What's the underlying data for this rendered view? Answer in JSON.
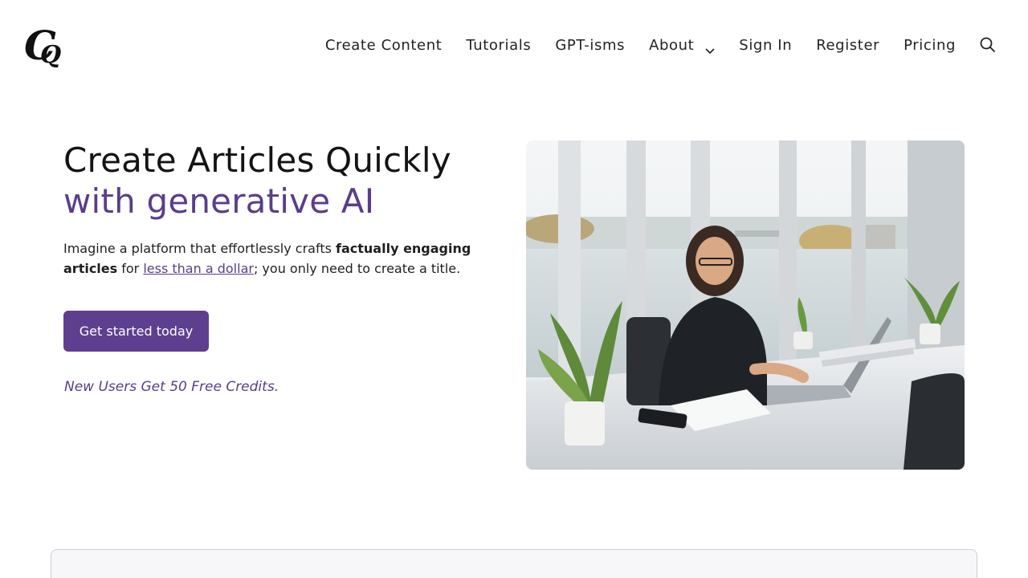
{
  "header": {
    "logo_text": "CQ",
    "nav": [
      {
        "label": "Create Content"
      },
      {
        "label": "Tutorials"
      },
      {
        "label": "GPT-isms"
      },
      {
        "label": "About"
      },
      {
        "label": "Sign In"
      },
      {
        "label": "Register"
      },
      {
        "label": "Pricing"
      }
    ]
  },
  "hero": {
    "title_main": "Create Articles Quickly ",
    "title_accent": "with generative AI",
    "desc_part1": "Imagine a platform that effortlessly crafts ",
    "desc_bold": "factually engaging articles",
    "desc_part2": " for ",
    "desc_link": "less than a dollar",
    "desc_part3": "; you only need to create a title.",
    "cta_label": "Get started today",
    "credits_note": "New Users Get 50 Free Credits."
  },
  "colors": {
    "accent": "#5a3d8a",
    "button": "#5e3f8f"
  },
  "icons": {
    "about_dropdown": "chevron-down-icon",
    "search": "search-icon"
  }
}
